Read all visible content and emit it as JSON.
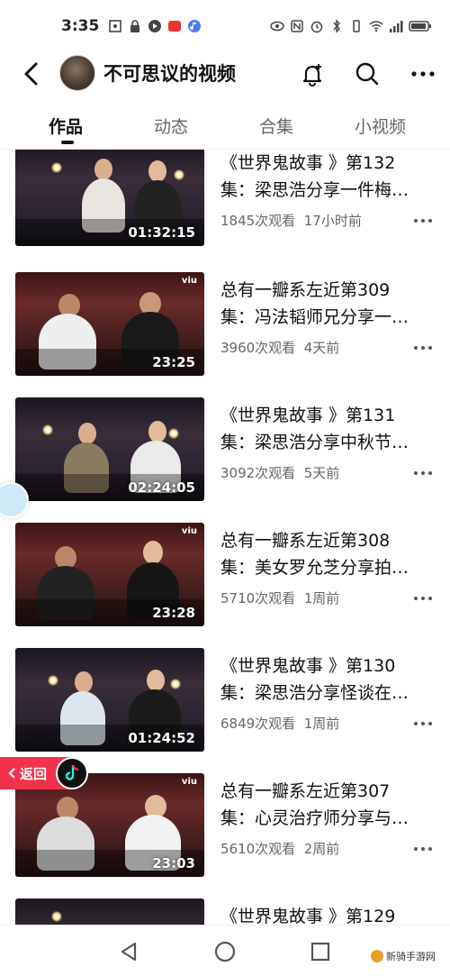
{
  "status_bar": {
    "time": "3:35",
    "battery_icon": "battery-icon",
    "wifi_icon": "wifi-icon"
  },
  "header": {
    "back_icon": "back-arrow-icon",
    "title": "不可思议的视频",
    "actions": [
      "bell-plus-icon",
      "search-icon",
      "more-icon"
    ]
  },
  "tabs": [
    {
      "label": "作品",
      "active": true
    },
    {
      "label": "动态",
      "active": false
    },
    {
      "label": "合集",
      "active": false
    },
    {
      "label": "小视频",
      "active": false
    }
  ],
  "videos": [
    {
      "title_line1": "《世界鬼故事 》第132",
      "title_line2": "集：梁思浩分享一件梅…",
      "views": "1845次观看",
      "time": "17小时前",
      "duration": "01:32:15",
      "style": "ghost"
    },
    {
      "title_line1": "总有一瓣系左近第309",
      "title_line2": "集：冯法韬师兄分享一…",
      "views": "3960次观看",
      "time": "4天前",
      "duration": "23:25",
      "style": "viu"
    },
    {
      "title_line1": "《世界鬼故事 》第131",
      "title_line2": "集：梁思浩分享中秋节…",
      "views": "3092次观看",
      "time": "5天前",
      "duration": "02:24:05",
      "style": "ghost"
    },
    {
      "title_line1": "总有一瓣系左近第308",
      "title_line2": "集：美女罗允芝分享拍…",
      "views": "5710次观看",
      "time": "1周前",
      "duration": "23:28",
      "style": "viu"
    },
    {
      "title_line1": "《世界鬼故事 》第130",
      "title_line2": "集：梁思浩分享怪谈在…",
      "views": "6849次观看",
      "time": "1周前",
      "duration": "01:24:52",
      "style": "ghost"
    },
    {
      "title_line1": "总有一瓣系左近第307",
      "title_line2": "集：心灵治疗师分享与…",
      "views": "5610次观看",
      "time": "2周前",
      "duration": "23:03",
      "style": "viu"
    },
    {
      "title_line1": "《世界鬼故事 》第129",
      "title_line2": "",
      "views": "",
      "time": "",
      "duration": "",
      "style": "ghost"
    }
  ],
  "return_button": {
    "label": "返回"
  },
  "viu_label": "viu",
  "watermark": "新骑手游网",
  "colors": {
    "accent_red": "#f2324c",
    "text_primary": "#111111",
    "text_secondary": "#666666"
  }
}
